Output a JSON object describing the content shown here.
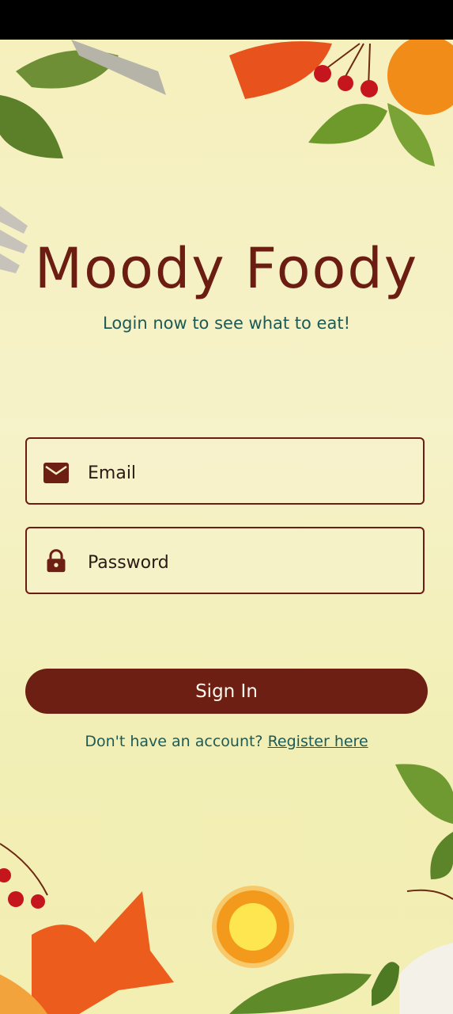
{
  "app": {
    "title": "Moody Foody",
    "subtitle": "Login now to see what to eat!"
  },
  "form": {
    "email_placeholder": "Email",
    "password_placeholder": "Password",
    "email_value": "",
    "password_value": ""
  },
  "actions": {
    "signin_label": "Sign In",
    "no_account_text": "Don't have an account?",
    "register_label": "Register here"
  },
  "icons": {
    "email": "envelope-icon",
    "password": "lock-icon"
  },
  "colors": {
    "primary": "#6e1f13",
    "accent_text": "#1e5a55",
    "background": "#f3f0bf"
  }
}
